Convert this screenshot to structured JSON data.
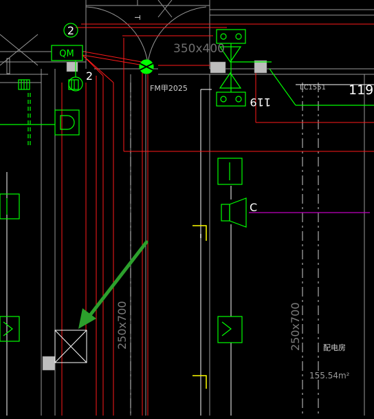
{
  "labels": {
    "qm": "QM",
    "callout_top": "2",
    "callout_bottom": "2",
    "door_fm": "FM甲2025",
    "duct_top": "350x400",
    "door_lc": "LC1551",
    "room_no_mirror": "119",
    "room_no_right": "119",
    "sym_c": "C",
    "duct_left": "250x700",
    "duct_right": "250x700",
    "room_name": "配电房",
    "room_area": "155.54m²"
  },
  "colors": {
    "background": "#000000",
    "green": "#00ff00",
    "red": "#ff1a1a",
    "white": "#ffffff",
    "grey": "#9a9a9a",
    "magenta": "#c000c0",
    "yellow": "#ffff00",
    "arrow": "#2ca02c"
  }
}
